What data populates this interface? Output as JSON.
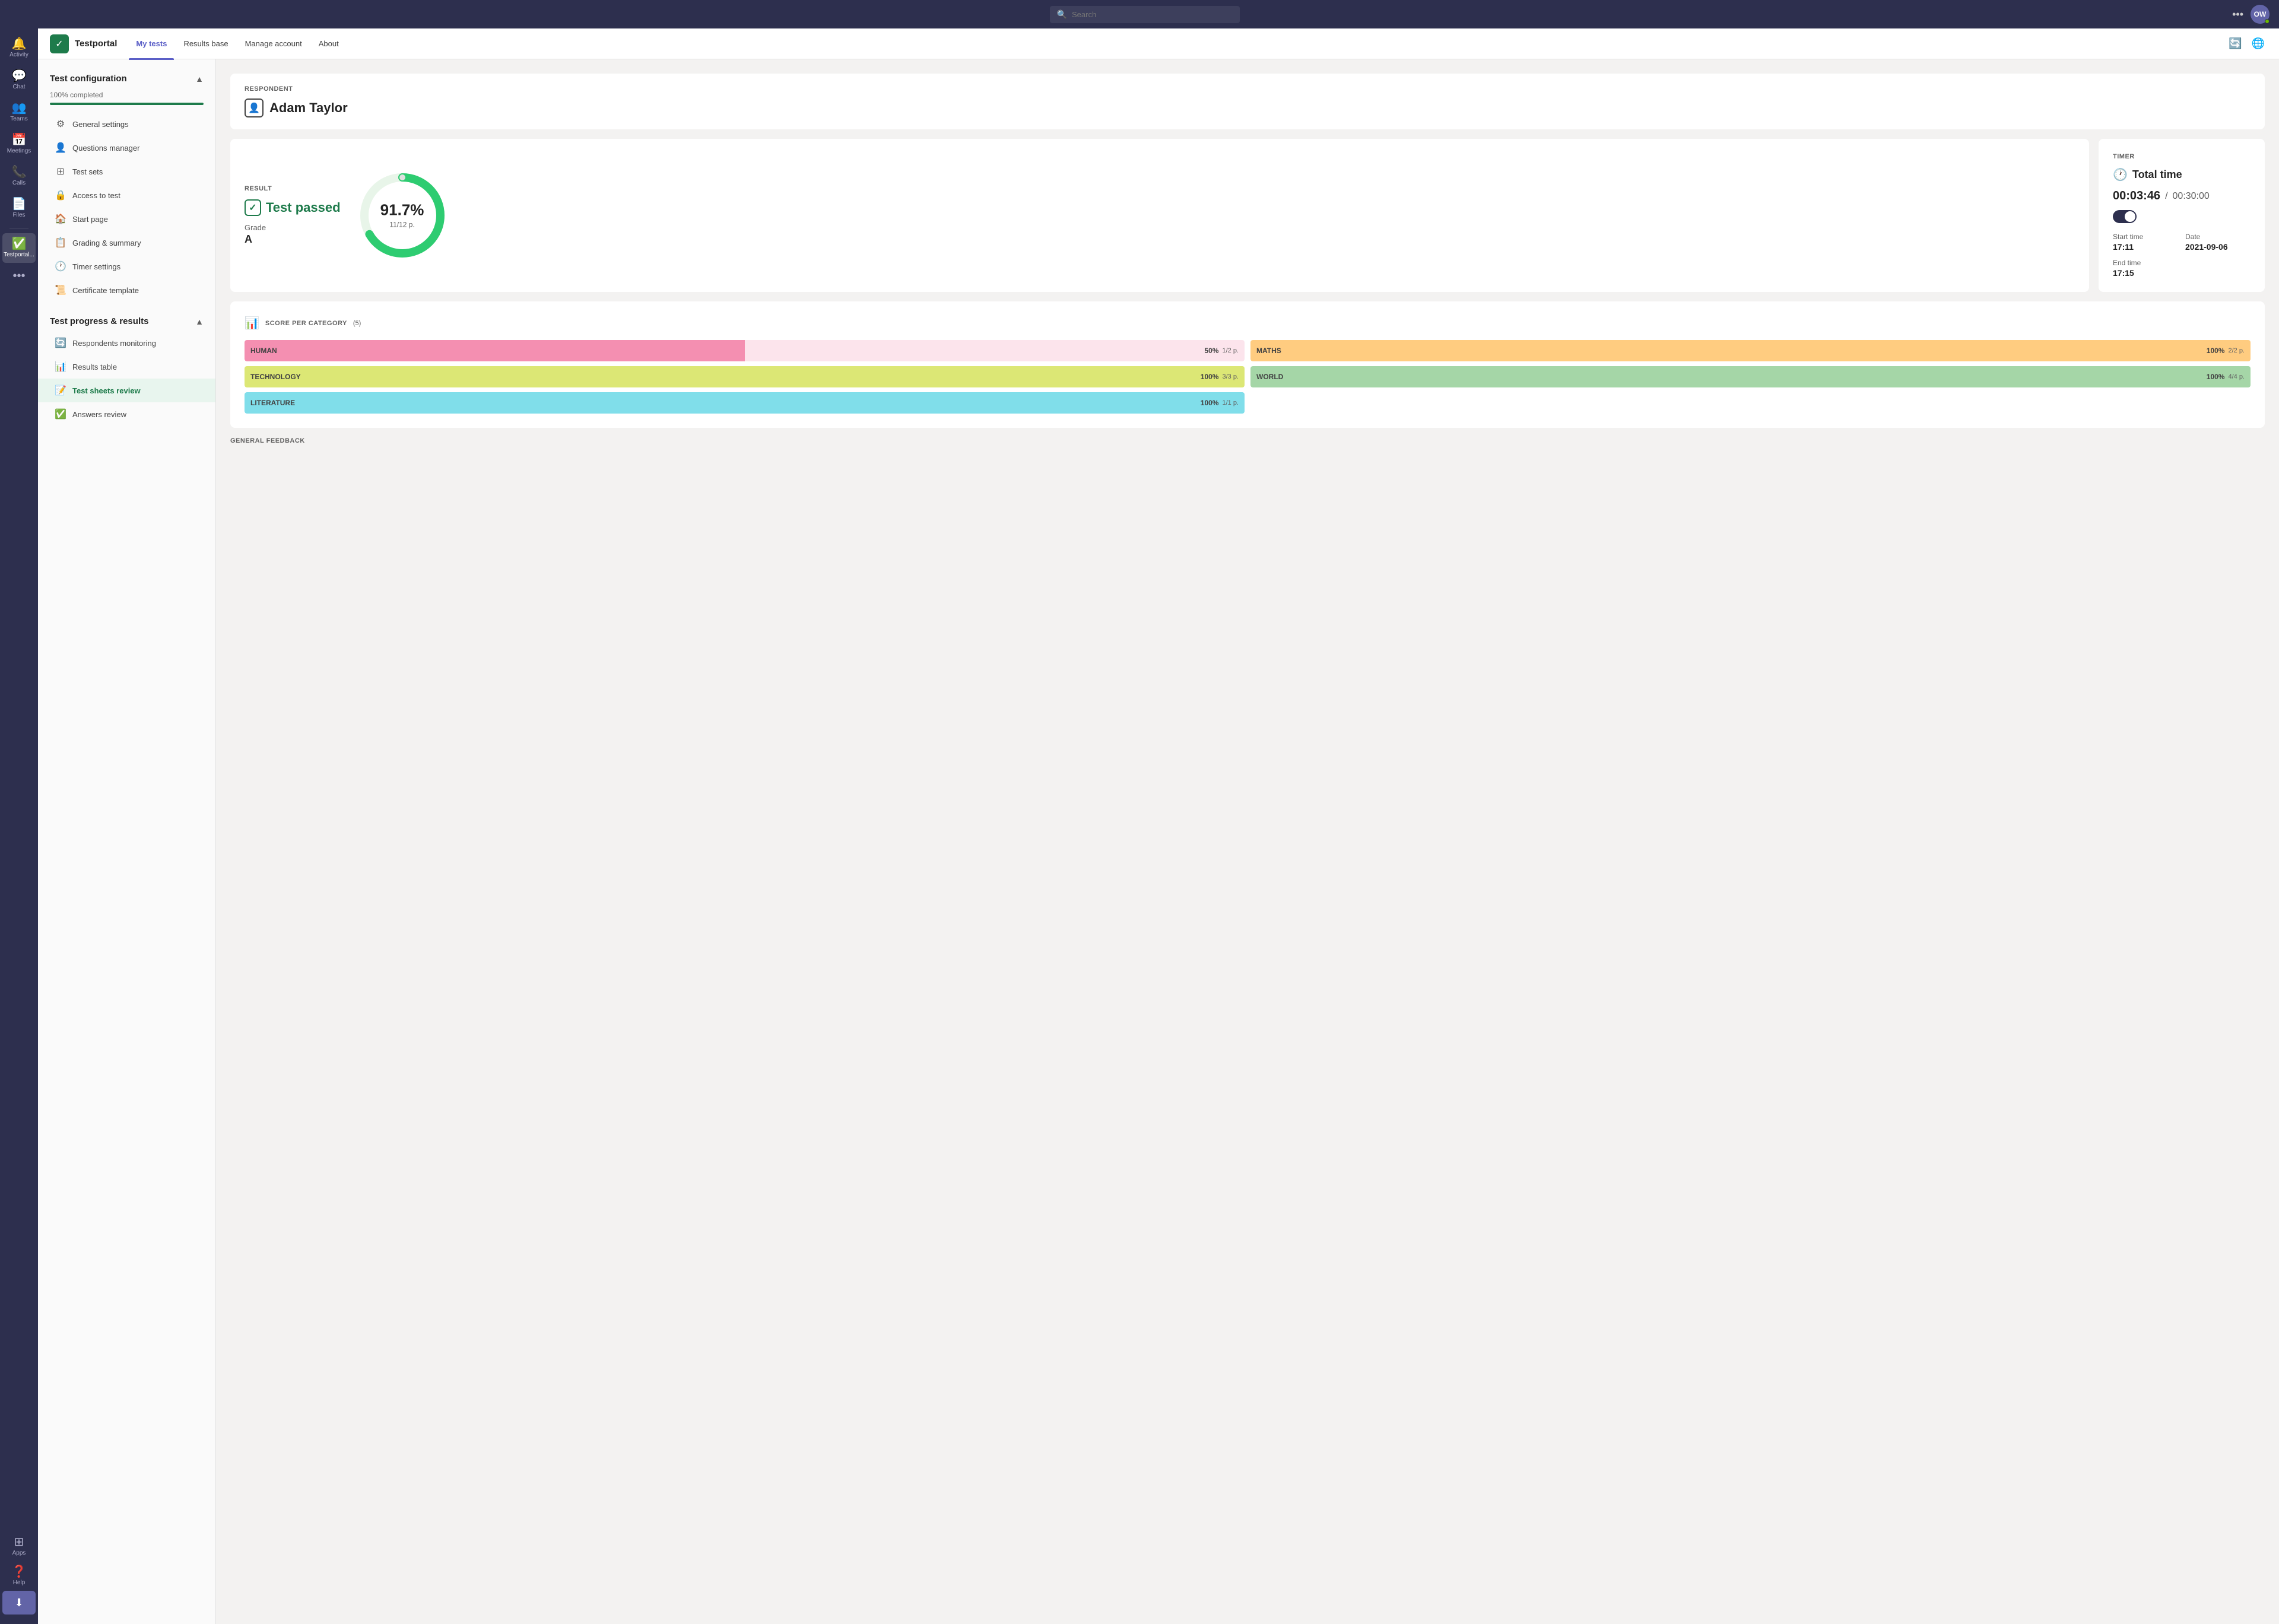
{
  "topbar": {
    "search_placeholder": "Search"
  },
  "sidebar": {
    "items": [
      {
        "id": "activity",
        "label": "Activity",
        "icon": "🔔"
      },
      {
        "id": "chat",
        "label": "Chat",
        "icon": "💬"
      },
      {
        "id": "teams",
        "label": "Teams",
        "icon": "👥"
      },
      {
        "id": "meetings",
        "label": "Meetings",
        "icon": "📅"
      },
      {
        "id": "calls",
        "label": "Calls",
        "icon": "📞"
      },
      {
        "id": "files",
        "label": "Files",
        "icon": "📄"
      },
      {
        "id": "testportal",
        "label": "Testportal...",
        "icon": "✅"
      }
    ],
    "more_label": "•••",
    "apps_label": "Apps",
    "help_label": "Help",
    "download_icon": "⬇"
  },
  "header": {
    "app_name": "Testportal",
    "nav_items": [
      {
        "id": "my_tests",
        "label": "My tests",
        "active": true
      },
      {
        "id": "results_base",
        "label": "Results base",
        "active": false
      },
      {
        "id": "manage_account",
        "label": "Manage account",
        "active": false
      },
      {
        "id": "about",
        "label": "About",
        "active": false
      }
    ]
  },
  "left_panel": {
    "section1": {
      "title": "Test configuration",
      "progress_label": "100% completed",
      "progress_pct": 100,
      "items": [
        {
          "id": "general_settings",
          "label": "General settings",
          "icon": "⚙"
        },
        {
          "id": "questions_manager",
          "label": "Questions manager",
          "icon": "👤"
        },
        {
          "id": "test_sets",
          "label": "Test sets",
          "icon": "⊞"
        },
        {
          "id": "access_to_test",
          "label": "Access to test",
          "icon": "🔒"
        },
        {
          "id": "start_page",
          "label": "Start page",
          "icon": "🏠"
        },
        {
          "id": "grading_summary",
          "label": "Grading & summary",
          "icon": "📋"
        },
        {
          "id": "timer_settings",
          "label": "Timer settings",
          "icon": "🕐"
        },
        {
          "id": "certificate_template",
          "label": "Certificate template",
          "icon": "📜"
        }
      ]
    },
    "section2": {
      "title": "Test progress & results",
      "items": [
        {
          "id": "respondents_monitoring",
          "label": "Respondents monitoring",
          "icon": "🔄"
        },
        {
          "id": "results_table",
          "label": "Results table",
          "icon": "📊"
        },
        {
          "id": "test_sheets_review",
          "label": "Test sheets review",
          "icon": "📝",
          "active": true
        },
        {
          "id": "answers_review",
          "label": "Answers review",
          "icon": "✅"
        }
      ]
    }
  },
  "main": {
    "respondent": {
      "section_label": "RESPONDENT",
      "name": "Adam Taylor"
    },
    "result": {
      "section_label": "RESULT",
      "status": "Test passed",
      "grade_label": "Grade",
      "grade_value": "A",
      "percent": "91.7%",
      "score": "11/12 p."
    },
    "timer": {
      "section_label": "TIMER",
      "title": "Total time",
      "elapsed": "00:03:46",
      "separator": "/",
      "total": "00:30:00",
      "start_time_label": "Start time",
      "start_time_value": "17:11",
      "date_label": "Date",
      "date_value": "2021-09-06",
      "end_time_label": "End time",
      "end_time_value": "17:15"
    },
    "score_per_category": {
      "section_label": "SCORE PER CATEGORY",
      "count": "(5)",
      "categories": [
        {
          "id": "human",
          "name": "HUMAN",
          "pct": 50,
          "pct_label": "50%",
          "frac": "1/2 p.",
          "bg": "#fce4ec",
          "fill": "#f48fb1",
          "col": 0
        },
        {
          "id": "maths",
          "name": "MATHS",
          "pct": 100,
          "pct_label": "100%",
          "frac": "2/2 p.",
          "bg": "#fff3e0",
          "fill": "#ffcc80",
          "col": 1
        },
        {
          "id": "technology",
          "name": "TECHNOLOGY",
          "pct": 100,
          "pct_label": "100%",
          "frac": "3/3 p.",
          "bg": "#f9fbe7",
          "fill": "#dce775",
          "col": 0
        },
        {
          "id": "world",
          "name": "WORLD",
          "pct": 100,
          "pct_label": "100%",
          "frac": "4/4 p.",
          "bg": "#e8f5e9",
          "fill": "#a5d6a7",
          "col": 1
        },
        {
          "id": "literature",
          "name": "LITERATURE",
          "pct": 100,
          "pct_label": "100%",
          "frac": "1/1 p.",
          "bg": "#e0f7fa",
          "fill": "#80deea",
          "col": 0
        }
      ]
    },
    "general_feedback": {
      "section_label": "GENERAL FEEDBACK"
    }
  },
  "avatar": {
    "initials": "OW"
  }
}
